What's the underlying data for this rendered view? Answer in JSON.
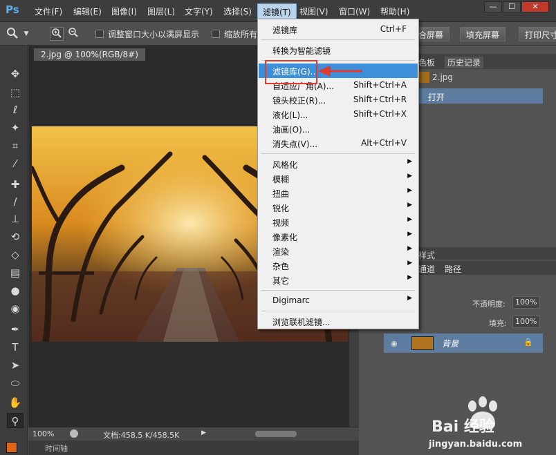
{
  "app": {
    "logo": "Ps",
    "menus": [
      "文件(F)",
      "编辑(E)",
      "图像(I)",
      "图层(L)",
      "文字(Y)",
      "选择(S)",
      "滤镜(T)",
      "视图(V)",
      "窗口(W)",
      "帮助(H)"
    ],
    "window_buttons": [
      "—",
      "☐",
      "✕"
    ]
  },
  "options": {
    "resize_window_label": "调整窗口大小以满屏显示",
    "zoom_all_label": "缩放所有",
    "fit_screen": "合屏幕",
    "fill_screen": "填充屏幕",
    "print_size": "打印尺寸"
  },
  "document": {
    "tab_title": "2.jpg @ 100%(RGB/8#)",
    "zoom": "100%",
    "doc_size": "文档:458.5 K/458.5K",
    "timeline": "时间轴"
  },
  "filter_menu": {
    "items": [
      {
        "label": "滤镜库",
        "shortcut": "Ctrl+F"
      },
      {
        "sep": true
      },
      {
        "label": "转换为智能滤镜"
      },
      {
        "sep": true
      },
      {
        "label": "滤镜库(G)...",
        "highlight": true
      },
      {
        "label": "自适应广角(A)...",
        "shortcut": "Shift+Ctrl+A"
      },
      {
        "label": "镜头校正(R)...",
        "shortcut": "Shift+Ctrl+R"
      },
      {
        "label": "液化(L)...",
        "shortcut": "Shift+Ctrl+X"
      },
      {
        "label": "油画(O)..."
      },
      {
        "label": "消失点(V)...",
        "shortcut": "Alt+Ctrl+V"
      },
      {
        "sep": true
      },
      {
        "label": "风格化",
        "submenu": true
      },
      {
        "label": "模糊",
        "submenu": true
      },
      {
        "label": "扭曲",
        "submenu": true
      },
      {
        "label": "锐化",
        "submenu": true
      },
      {
        "label": "视频",
        "submenu": true
      },
      {
        "label": "像素化",
        "submenu": true
      },
      {
        "label": "渲染",
        "submenu": true
      },
      {
        "label": "杂色",
        "submenu": true
      },
      {
        "label": "其它",
        "submenu": true
      },
      {
        "sep": true
      },
      {
        "label": "Digimarc",
        "submenu": true
      },
      {
        "sep": true
      },
      {
        "label": "浏览联机滤镜..."
      }
    ]
  },
  "panels": {
    "color_tab": "色板",
    "history_tab": "历史记录",
    "history_items": [
      "2.jpg",
      "打开"
    ],
    "styles_tab": "样式",
    "channels_tab": "通道",
    "paths_tab": "路径",
    "opacity_label": "不透明度:",
    "opacity_value": "100%",
    "fill_label": "填充:",
    "fill_value": "100%",
    "layer_name": "背景"
  },
  "watermark": {
    "brand": "Bai 经验",
    "url": "jingyan.baidu.com"
  },
  "colors": {
    "highlight": "#3c8fd8",
    "annotation_red": "#e23a2f",
    "foreground_swatch": "#e0641c"
  }
}
